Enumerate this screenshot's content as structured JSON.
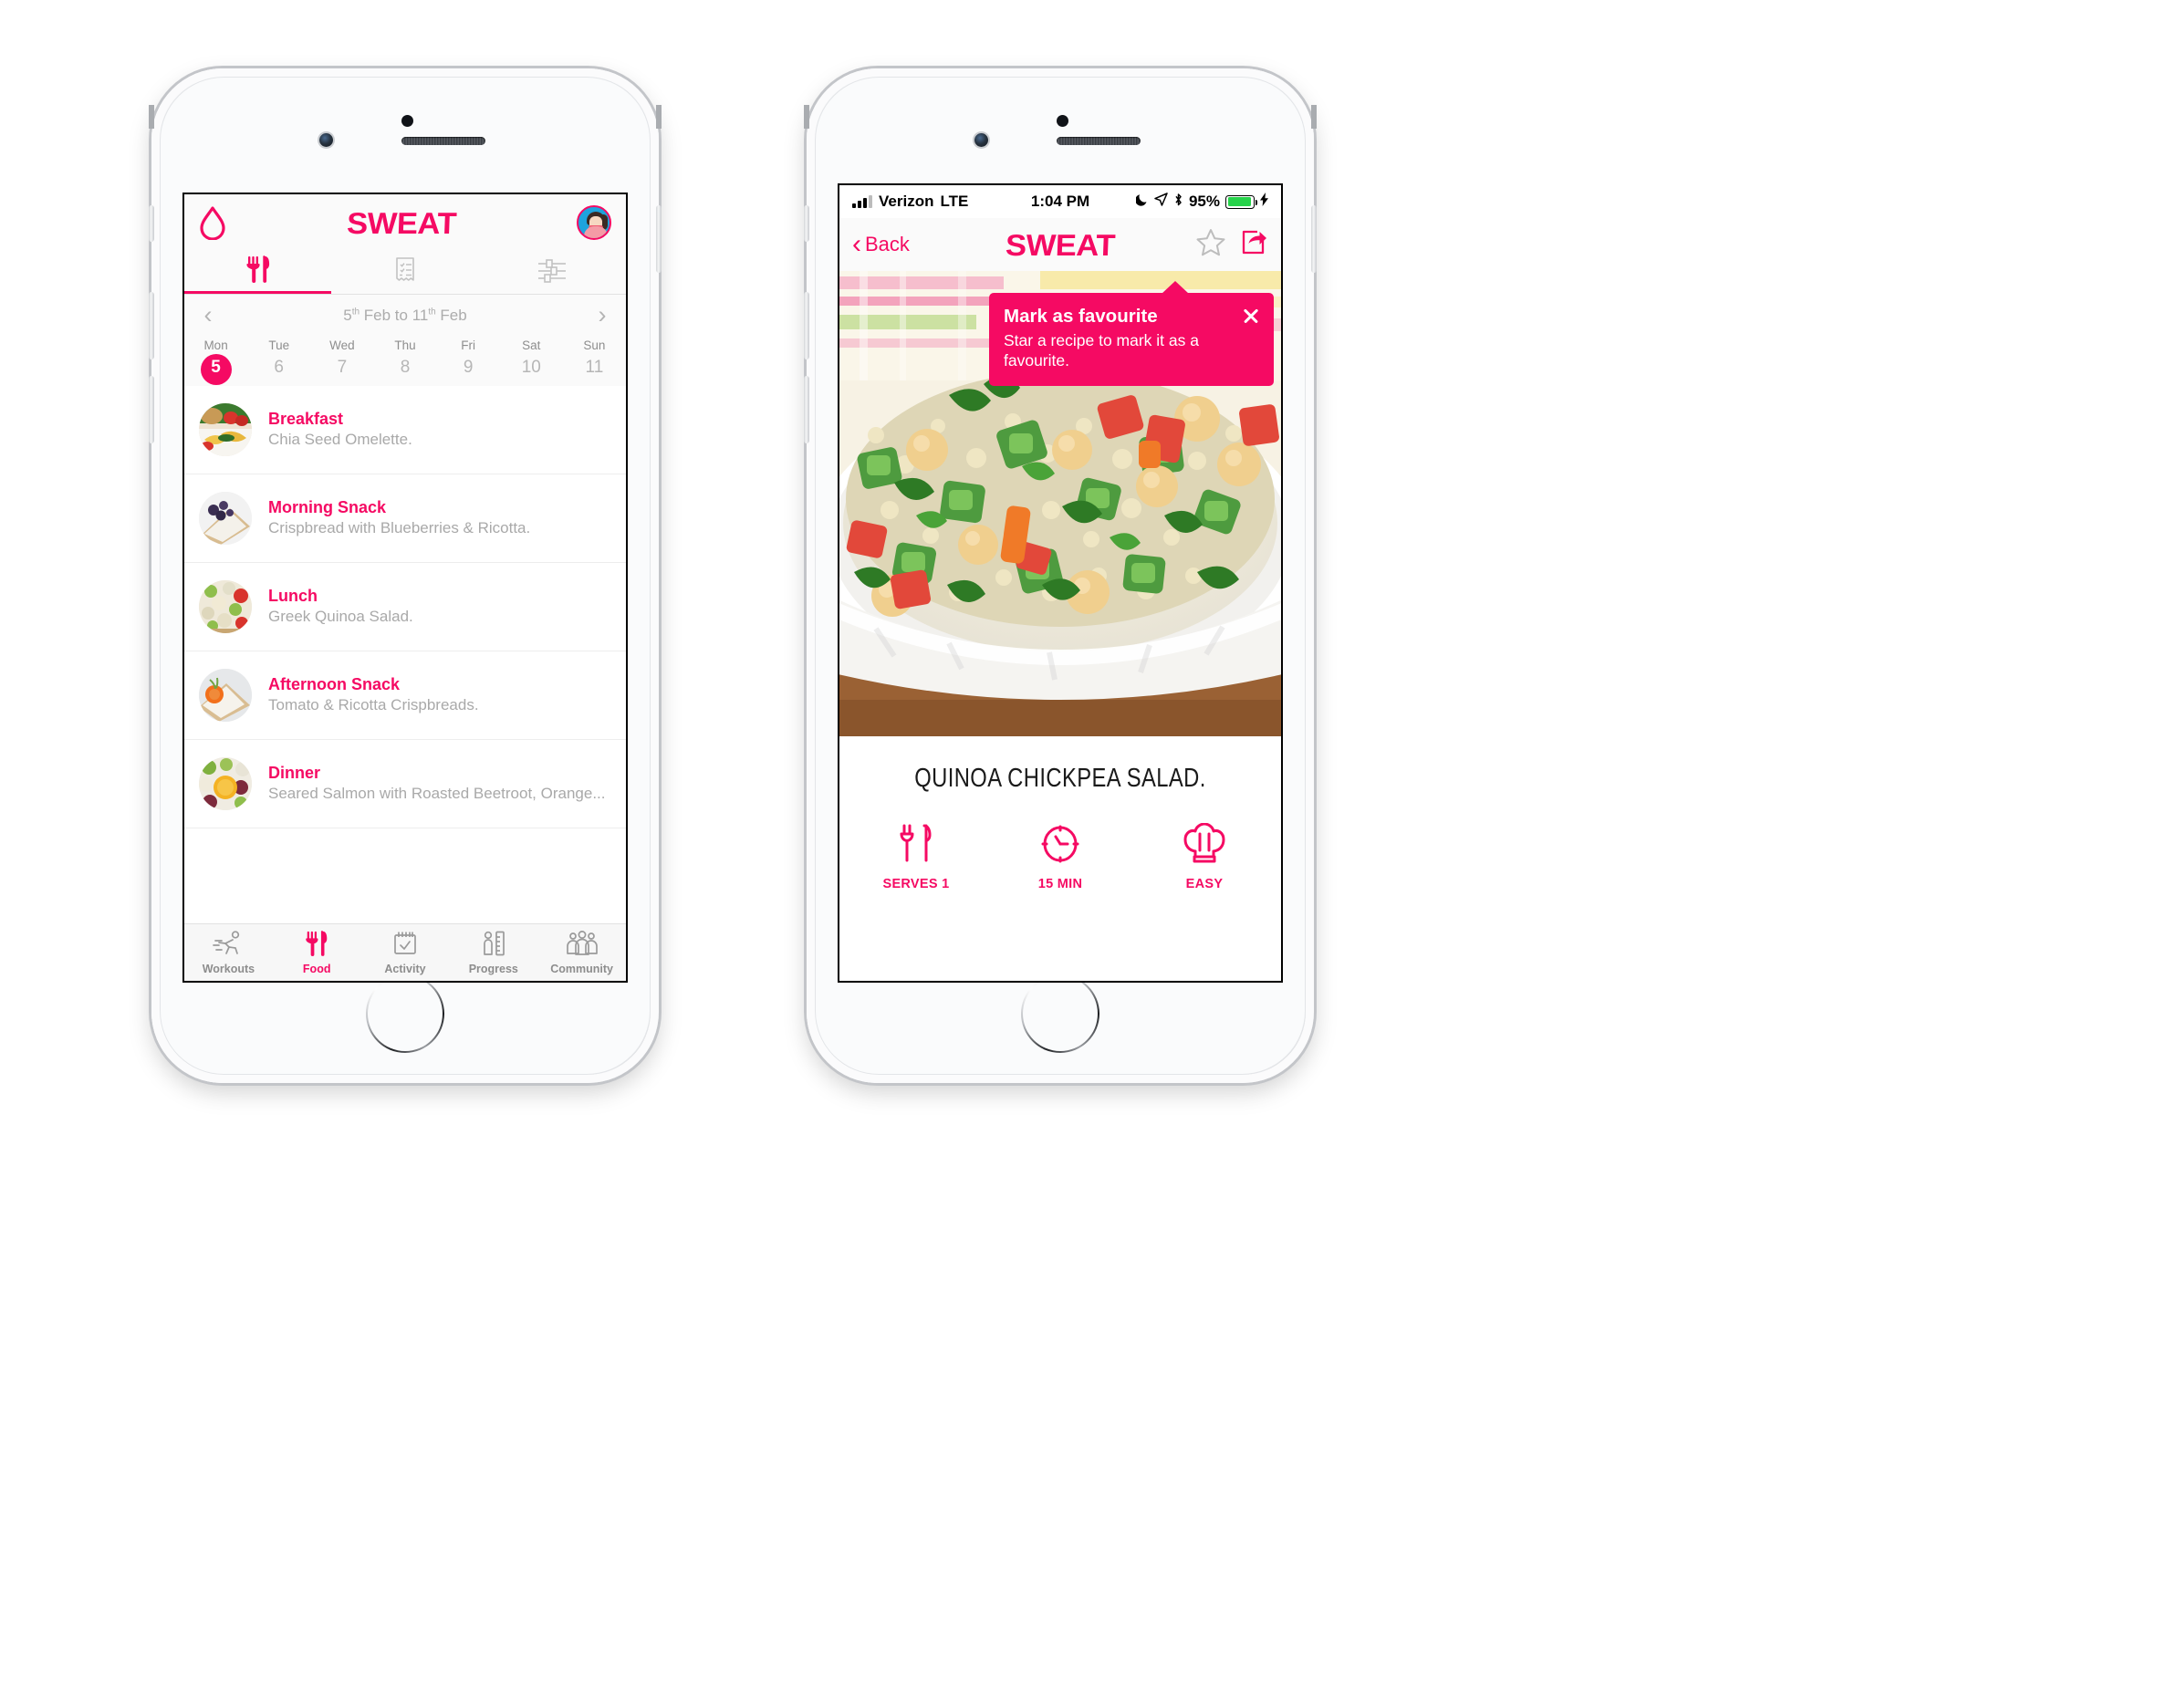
{
  "brand": {
    "name": "SWEAT",
    "accent": "#F50A63",
    "muted": "#a9a9a9"
  },
  "left_phone": {
    "header": {
      "water_icon": "water-drop-icon",
      "logo": "SWEAT",
      "avatar_icon": "user-avatar"
    },
    "tabs": [
      {
        "icon": "cutlery-icon",
        "name": "meals",
        "active": true
      },
      {
        "icon": "checklist-receipt-icon",
        "name": "shopping-list",
        "active": false
      },
      {
        "icon": "sliders-icon",
        "name": "preferences",
        "active": false
      }
    ],
    "week": {
      "prev_icon": "chevron-left-icon",
      "next_icon": "chevron-right-icon",
      "range_start_day": "5",
      "range_start_suffix": "th",
      "range_mid": " Feb to ",
      "range_end_day": "11",
      "range_end_suffix": "th",
      "range_end_month": " Feb",
      "day_names": [
        "Mon",
        "Tue",
        "Wed",
        "Thu",
        "Fri",
        "Sat",
        "Sun"
      ],
      "day_numbers": [
        "5",
        "6",
        "7",
        "8",
        "9",
        "10",
        "11"
      ],
      "selected_index": 0
    },
    "meals": [
      {
        "title": "Breakfast",
        "subtitle": "Chia Seed Omelette."
      },
      {
        "title": "Morning Snack",
        "subtitle": "Crispbread with Blueberries & Ricotta."
      },
      {
        "title": "Lunch",
        "subtitle": "Greek Quinoa Salad."
      },
      {
        "title": "Afternoon Snack",
        "subtitle": "Tomato & Ricotta Crispbreads."
      },
      {
        "title": "Dinner",
        "subtitle": "Seared Salmon with Roasted Beetroot, Orange..."
      }
    ],
    "tabbar": [
      {
        "label": "Workouts",
        "icon": "runner-icon",
        "active": false
      },
      {
        "label": "Food",
        "icon": "cutlery-icon",
        "active": true
      },
      {
        "label": "Activity",
        "icon": "calendar-check-icon",
        "active": false
      },
      {
        "label": "Progress",
        "icon": "body-ruler-icon",
        "active": false
      },
      {
        "label": "Community",
        "icon": "people-icon",
        "active": false
      }
    ]
  },
  "right_phone": {
    "statusbar": {
      "carrier": "Verizon",
      "network": "LTE",
      "time": "1:04 PM",
      "moon_icon": "do-not-disturb-moon-icon",
      "location_icon": "location-arrow-icon",
      "bluetooth_icon": "bluetooth-icon",
      "battery_percent": "95%",
      "battery_level": 95,
      "battery_color": "#27d34b",
      "charging_icon": "lightning-bolt-icon"
    },
    "header": {
      "back_label": "Back",
      "back_icon": "chevron-left-icon",
      "logo": "SWEAT",
      "favourite_icon": "star-outline-icon",
      "share_icon": "share-box-icon"
    },
    "tooltip": {
      "title": "Mark as favourite",
      "body": "Star a recipe to mark it as a favourite.",
      "close_icon": "close-x-icon",
      "background": "#F50A63"
    },
    "hero": {
      "image_alt": "quinoa-chickpea-salad-photo"
    },
    "recipe": {
      "title": "QUINOA CHICKPEA SALAD.",
      "stats": [
        {
          "icon": "cutlery-icon",
          "label": "SERVES 1"
        },
        {
          "icon": "clock-icon",
          "label": "15 MIN"
        },
        {
          "icon": "chef-hat-icon",
          "label": "EASY"
        }
      ]
    }
  }
}
